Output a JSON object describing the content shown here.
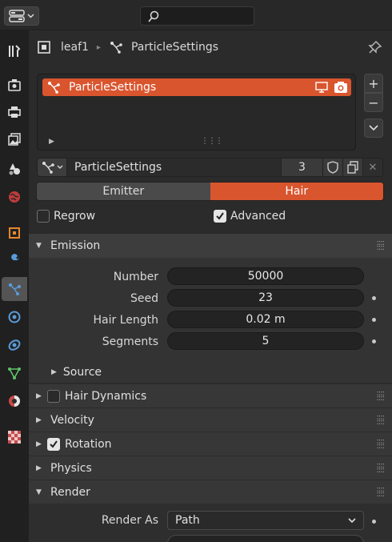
{
  "breadcrumb": {
    "object": "leaf1",
    "settings": "ParticleSettings"
  },
  "particle_list": {
    "items": [
      {
        "label": "ParticleSettings"
      }
    ]
  },
  "datablock": {
    "name": "ParticleSettings",
    "users": "3"
  },
  "type_toggle": {
    "options": [
      "Emitter",
      "Hair"
    ],
    "selected": "Hair"
  },
  "checks": {
    "regrow": {
      "label": "Regrow",
      "checked": false
    },
    "advanced": {
      "label": "Advanced",
      "checked": true
    }
  },
  "emission": {
    "title": "Emission",
    "props": [
      {
        "label": "Number",
        "value": "50000"
      },
      {
        "label": "Seed",
        "value": "23"
      },
      {
        "label": "Hair Length",
        "value": "0.02 m"
      },
      {
        "label": "Segments",
        "value": "5"
      }
    ],
    "source_label": "Source"
  },
  "panels": {
    "hair_dynamics": "Hair Dynamics",
    "velocity": "Velocity",
    "rotation": "Rotation",
    "physics": "Physics",
    "render": "Render"
  },
  "render": {
    "render_as_label": "Render As",
    "render_as_value": "Path"
  },
  "colors": {
    "accent": "#d9552e",
    "bg": "#303030"
  }
}
